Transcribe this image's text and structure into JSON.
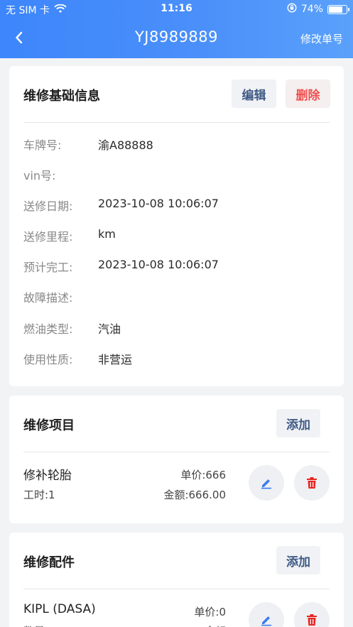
{
  "status": {
    "carrier": "无 SIM 卡",
    "time": "11:16",
    "battery": "74%"
  },
  "nav": {
    "title": "YJ8989889",
    "right_action": "修改单号"
  },
  "basic": {
    "title": "维修基础信息",
    "edit": "编辑",
    "delete": "删除",
    "rows": [
      {
        "label": "车牌号:",
        "value": "渝A88888"
      },
      {
        "label": "vin号:",
        "value": ""
      },
      {
        "label": "送修日期:",
        "value": "2023-10-08 10:06:07"
      },
      {
        "label": "送修里程:",
        "value": "km"
      },
      {
        "label": "预计完工:",
        "value": "2023-10-08 10:06:07"
      },
      {
        "label": "故障描述:",
        "value": ""
      },
      {
        "label": "燃油类型:",
        "value": "汽油"
      },
      {
        "label": "使用性质:",
        "value": "非营运"
      }
    ]
  },
  "items": {
    "title": "维修项目",
    "add": "添加",
    "list": [
      {
        "name": "修补轮胎",
        "hours": "工时:1",
        "price": "单价:666",
        "amount": "金额:666.00"
      }
    ]
  },
  "parts": {
    "title": "维修配件",
    "add": "添加",
    "list": [
      {
        "name": "KIPL (DASA)",
        "qty": "数量",
        "price": "单价:0",
        "amount": "金额"
      }
    ]
  },
  "colors": {
    "header": "#4a8ffa",
    "edit_icon": "#3b7cf0",
    "delete_icon": "#e8231f"
  }
}
